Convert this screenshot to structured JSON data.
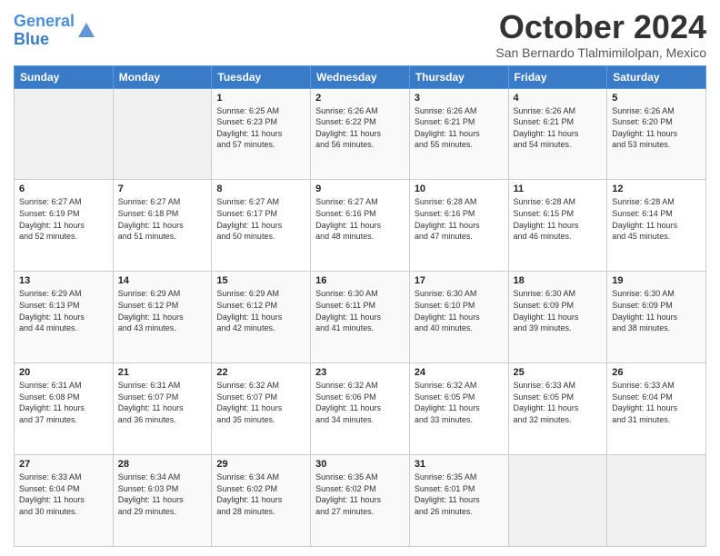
{
  "header": {
    "logo_line1": "General",
    "logo_line2": "Blue",
    "month": "October 2024",
    "location": "San Bernardo Tlalmimilolpan, Mexico"
  },
  "days_header": [
    "Sunday",
    "Monday",
    "Tuesday",
    "Wednesday",
    "Thursday",
    "Friday",
    "Saturday"
  ],
  "weeks": [
    [
      {
        "day": "",
        "content": ""
      },
      {
        "day": "",
        "content": ""
      },
      {
        "day": "1",
        "content": "Sunrise: 6:25 AM\nSunset: 6:23 PM\nDaylight: 11 hours\nand 57 minutes."
      },
      {
        "day": "2",
        "content": "Sunrise: 6:26 AM\nSunset: 6:22 PM\nDaylight: 11 hours\nand 56 minutes."
      },
      {
        "day": "3",
        "content": "Sunrise: 6:26 AM\nSunset: 6:21 PM\nDaylight: 11 hours\nand 55 minutes."
      },
      {
        "day": "4",
        "content": "Sunrise: 6:26 AM\nSunset: 6:21 PM\nDaylight: 11 hours\nand 54 minutes."
      },
      {
        "day": "5",
        "content": "Sunrise: 6:26 AM\nSunset: 6:20 PM\nDaylight: 11 hours\nand 53 minutes."
      }
    ],
    [
      {
        "day": "6",
        "content": "Sunrise: 6:27 AM\nSunset: 6:19 PM\nDaylight: 11 hours\nand 52 minutes."
      },
      {
        "day": "7",
        "content": "Sunrise: 6:27 AM\nSunset: 6:18 PM\nDaylight: 11 hours\nand 51 minutes."
      },
      {
        "day": "8",
        "content": "Sunrise: 6:27 AM\nSunset: 6:17 PM\nDaylight: 11 hours\nand 50 minutes."
      },
      {
        "day": "9",
        "content": "Sunrise: 6:27 AM\nSunset: 6:16 PM\nDaylight: 11 hours\nand 48 minutes."
      },
      {
        "day": "10",
        "content": "Sunrise: 6:28 AM\nSunset: 6:16 PM\nDaylight: 11 hours\nand 47 minutes."
      },
      {
        "day": "11",
        "content": "Sunrise: 6:28 AM\nSunset: 6:15 PM\nDaylight: 11 hours\nand 46 minutes."
      },
      {
        "day": "12",
        "content": "Sunrise: 6:28 AM\nSunset: 6:14 PM\nDaylight: 11 hours\nand 45 minutes."
      }
    ],
    [
      {
        "day": "13",
        "content": "Sunrise: 6:29 AM\nSunset: 6:13 PM\nDaylight: 11 hours\nand 44 minutes."
      },
      {
        "day": "14",
        "content": "Sunrise: 6:29 AM\nSunset: 6:12 PM\nDaylight: 11 hours\nand 43 minutes."
      },
      {
        "day": "15",
        "content": "Sunrise: 6:29 AM\nSunset: 6:12 PM\nDaylight: 11 hours\nand 42 minutes."
      },
      {
        "day": "16",
        "content": "Sunrise: 6:30 AM\nSunset: 6:11 PM\nDaylight: 11 hours\nand 41 minutes."
      },
      {
        "day": "17",
        "content": "Sunrise: 6:30 AM\nSunset: 6:10 PM\nDaylight: 11 hours\nand 40 minutes."
      },
      {
        "day": "18",
        "content": "Sunrise: 6:30 AM\nSunset: 6:09 PM\nDaylight: 11 hours\nand 39 minutes."
      },
      {
        "day": "19",
        "content": "Sunrise: 6:30 AM\nSunset: 6:09 PM\nDaylight: 11 hours\nand 38 minutes."
      }
    ],
    [
      {
        "day": "20",
        "content": "Sunrise: 6:31 AM\nSunset: 6:08 PM\nDaylight: 11 hours\nand 37 minutes."
      },
      {
        "day": "21",
        "content": "Sunrise: 6:31 AM\nSunset: 6:07 PM\nDaylight: 11 hours\nand 36 minutes."
      },
      {
        "day": "22",
        "content": "Sunrise: 6:32 AM\nSunset: 6:07 PM\nDaylight: 11 hours\nand 35 minutes."
      },
      {
        "day": "23",
        "content": "Sunrise: 6:32 AM\nSunset: 6:06 PM\nDaylight: 11 hours\nand 34 minutes."
      },
      {
        "day": "24",
        "content": "Sunrise: 6:32 AM\nSunset: 6:05 PM\nDaylight: 11 hours\nand 33 minutes."
      },
      {
        "day": "25",
        "content": "Sunrise: 6:33 AM\nSunset: 6:05 PM\nDaylight: 11 hours\nand 32 minutes."
      },
      {
        "day": "26",
        "content": "Sunrise: 6:33 AM\nSunset: 6:04 PM\nDaylight: 11 hours\nand 31 minutes."
      }
    ],
    [
      {
        "day": "27",
        "content": "Sunrise: 6:33 AM\nSunset: 6:04 PM\nDaylight: 11 hours\nand 30 minutes."
      },
      {
        "day": "28",
        "content": "Sunrise: 6:34 AM\nSunset: 6:03 PM\nDaylight: 11 hours\nand 29 minutes."
      },
      {
        "day": "29",
        "content": "Sunrise: 6:34 AM\nSunset: 6:02 PM\nDaylight: 11 hours\nand 28 minutes."
      },
      {
        "day": "30",
        "content": "Sunrise: 6:35 AM\nSunset: 6:02 PM\nDaylight: 11 hours\nand 27 minutes."
      },
      {
        "day": "31",
        "content": "Sunrise: 6:35 AM\nSunset: 6:01 PM\nDaylight: 11 hours\nand 26 minutes."
      },
      {
        "day": "",
        "content": ""
      },
      {
        "day": "",
        "content": ""
      }
    ]
  ]
}
